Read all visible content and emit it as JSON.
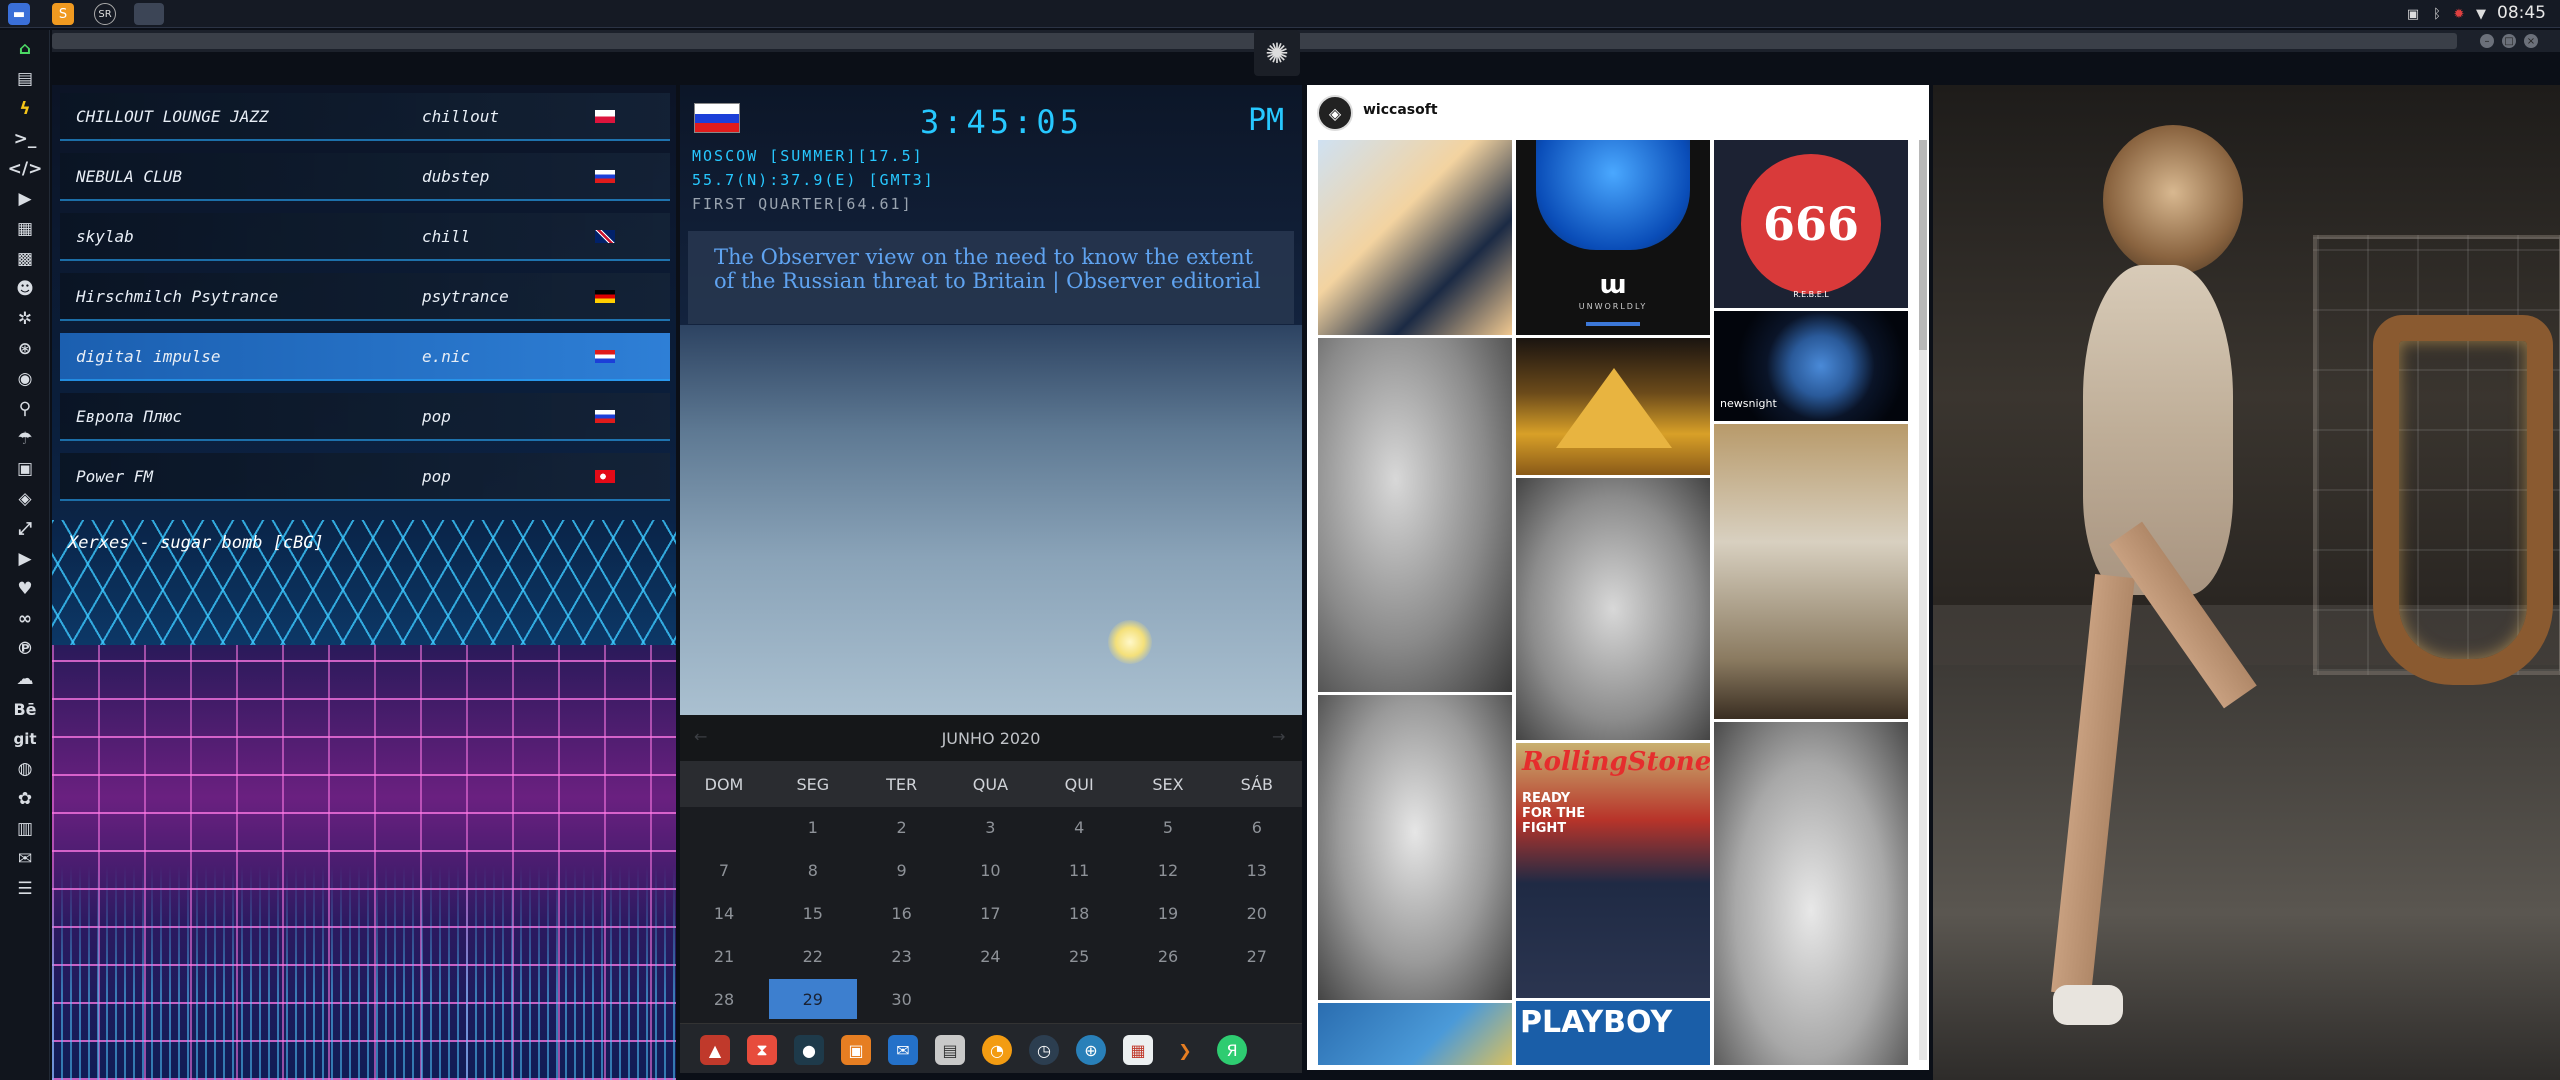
{
  "topbar": {
    "apps": [
      "files-icon",
      "sublime-icon",
      "sr-icon",
      "window-icon"
    ],
    "sr_label": "SR",
    "clock": "08:45",
    "tray_icons": [
      "screen-icon",
      "bluetooth-icon",
      "bug-icon",
      "wifi-icon"
    ]
  },
  "dock": {
    "icons": [
      "home-icon",
      "document-icon",
      "lightning-icon",
      "terminal-icon",
      "code-icon",
      "play-icon",
      "media-icon",
      "image-icon",
      "contact-icon",
      "settings-icon",
      "circles-icon",
      "globe-icon",
      "search-icon",
      "umbrella-icon",
      "id-card-icon",
      "tag-icon",
      "expand-icon",
      "youtube-icon",
      "heart-icon",
      "link-icon",
      "pinterest-icon",
      "cloud-icon",
      "behance-icon",
      "git-icon",
      "github-icon",
      "settings-alt-icon",
      "map-icon",
      "mail-icon",
      "list-icon"
    ],
    "behance_label": "Bē",
    "git_label": "git"
  },
  "radio": {
    "stations": [
      {
        "name": "CHILLOUT LOUNGE JAZZ",
        "genre": "chillout",
        "flag": "pl",
        "active": false
      },
      {
        "name": "NEBULA CLUB",
        "genre": "dubstep",
        "flag": "ru",
        "active": false
      },
      {
        "name": "skylab",
        "genre": "chill",
        "flag": "uk",
        "active": false
      },
      {
        "name": "Hirschmilch Psytrance",
        "genre": "psytrance",
        "flag": "de",
        "active": false
      },
      {
        "name": "digital impulse",
        "genre": "e.nic",
        "flag": "hr",
        "active": true
      },
      {
        "name": "Европа Плюс",
        "genre": "pop",
        "flag": "ru",
        "active": false
      },
      {
        "name": "Power FM",
        "genre": "pop",
        "flag": "tr",
        "active": false
      }
    ],
    "now_playing": "Xerxes - sugar bomb [cBG]"
  },
  "clock_widget": {
    "time": "3:45:05",
    "ampm": "PM",
    "city_line": "MOSCOW [SUMMER][17.5]",
    "coords_line": "55.7(N):37.9(E) [GMT3]",
    "moon_line": "FIRST QUARTER[64.61]",
    "news": "The Observer view on the need to know the extent of the Russian threat to Britain | Observer editorial"
  },
  "calendar": {
    "title": "JUNHO 2020",
    "days": [
      "DOM",
      "SEG",
      "TER",
      "QUA",
      "QUI",
      "SEX",
      "SÁB"
    ],
    "weeks": [
      [
        "",
        "1",
        "2",
        "3",
        "4",
        "5",
        "6"
      ],
      [
        "7",
        "8",
        "9",
        "10",
        "11",
        "12",
        "13"
      ],
      [
        "14",
        "15",
        "16",
        "17",
        "18",
        "19",
        "20"
      ],
      [
        "21",
        "22",
        "23",
        "24",
        "25",
        "26",
        "27"
      ],
      [
        "28",
        "29",
        "30",
        "",
        "",
        "",
        ""
      ]
    ],
    "today": "29"
  },
  "taskbar": {
    "icons": [
      "triangle-app-icon",
      "hourglass-icon",
      "planet-icon",
      "photos-icon",
      "outlook-icon",
      "news-icon",
      "firefox-icon",
      "clock-app-icon",
      "globe-app-icon",
      "calendar-app-icon",
      "arrow-app-icon",
      "yandex-icon"
    ],
    "yandex_label": "Я"
  },
  "instagram": {
    "username": "wiccasoft",
    "tiles": [
      {
        "label": "",
        "kind": "portrait"
      },
      {
        "label": "UNWORLDLY",
        "kind": "flower"
      },
      {
        "label": "666",
        "kind": "logo"
      },
      {
        "label": "",
        "kind": "statue"
      },
      {
        "label": "",
        "kind": "pyramid"
      },
      {
        "label": "newsnight",
        "kind": "earth"
      },
      {
        "label": "",
        "kind": "statue"
      },
      {
        "label": "",
        "kind": "statue"
      },
      {
        "label": "",
        "kind": "statue"
      },
      {
        "label": "RollingStone",
        "kind": "magazine"
      },
      {
        "label": "",
        "kind": "statue"
      },
      {
        "label": "PLAYBOY",
        "kind": "magazine"
      }
    ],
    "headline": "READY FOR THE FIGHT",
    "logo_sub": "R.E.B.E.L"
  },
  "photo": {
    "caption": ""
  },
  "colors": {
    "accent": "#27c8ff",
    "selected": "#2e7fd6",
    "today": "#3d7fcf"
  }
}
